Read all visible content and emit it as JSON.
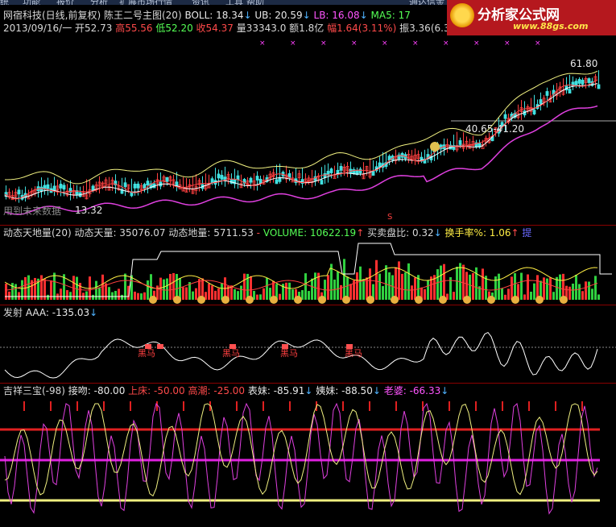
{
  "menu": [
    "统",
    "功能",
    "报价",
    "分析",
    "扩展市场行情",
    "资讯",
    "工具",
    "帮助",
    "通达信金"
  ],
  "logo": {
    "title": "分析家公式网",
    "url": "www.88gs.com"
  },
  "main": {
    "row1": [
      {
        "t": "网宿科技(日线,前复权) 陈王二号主图(20)",
        "c": "#d8d8d8"
      },
      {
        "t": "  BOLL: 18.34",
        "c": "#e8e8e8"
      },
      {
        "t": "↓",
        "c": "#4fb3ff"
      },
      {
        "t": "  UB: 20.59",
        "c": "#e8e8e8"
      },
      {
        "t": "↓",
        "c": "#4fb3ff"
      },
      {
        "t": "  LB: 16.08",
        "c": "#ff55ff"
      },
      {
        "t": "↓",
        "c": "#4fb3ff"
      },
      {
        "t": "        MA5: 17",
        "c": "#55ff55"
      }
    ],
    "row2": [
      {
        "t": "2013/09/16/一 开52.73 ",
        "c": "#d8d8d8"
      },
      {
        "t": "高55.56 ",
        "c": "#ff4a4a"
      },
      {
        "t": "低52.20 ",
        "c": "#55ff55"
      },
      {
        "t": "收54.37 ",
        "c": "#ff4a4a"
      },
      {
        "t": "量33343.0 额1.8亿 ",
        "c": "#d8d8d8"
      },
      {
        "t": "幅1.64(3.11%) ",
        "c": "#ff4a4a"
      },
      {
        "t": "振3.36(6.37%) 换3.3",
        "c": "#d8d8d8"
      }
    ],
    "price_labels": {
      "high": "61.80",
      "mid": "40.65-41.20",
      "low": "13.32"
    },
    "future_text": "用到未来数据"
  },
  "volume": {
    "row": [
      {
        "t": "动态天地量(20) 动态天量: 35076.07 动态地量: 5711.53",
        "c": "#d8d8d8"
      },
      {
        "t": "  -",
        "c": "#ff4a4a"
      },
      {
        "t": "       VOLUME: 10622.19",
        "c": "#55ff55"
      },
      {
        "t": "↑",
        "c": "#ff4a4a"
      },
      {
        "t": "          买卖盘比: 0.32",
        "c": "#d8d8d8"
      },
      {
        "t": "↓",
        "c": "#4fb3ff"
      },
      {
        "t": "   换手率%: 1.06",
        "c": "#ffee44"
      },
      {
        "t": "↑",
        "c": "#ff4a4a"
      },
      {
        "t": "  提",
        "c": "#6a6aff"
      }
    ]
  },
  "fire": {
    "row": [
      {
        "t": "发射",
        "c": "#d8d8d8"
      },
      {
        "t": "     AAA: -135.03",
        "c": "#e8e8e8"
      },
      {
        "t": "↓",
        "c": "#4fb3ff"
      }
    ],
    "marks": [
      "黑马",
      "黑马",
      "黑马",
      "黑马"
    ]
  },
  "jixiang": {
    "row": [
      {
        "t": "吉祥三宝(-98)",
        "c": "#d8d8d8"
      },
      {
        "t": "  接吻: -80.00",
        "c": "#e8e8e8"
      },
      {
        "t": "  上床: -50.00",
        "c": "#ff4a4a"
      },
      {
        "t": "  高潮: -25.00",
        "c": "#ff4a4a"
      },
      {
        "t": "  表妹: -85.91",
        "c": "#e8e8e8"
      },
      {
        "t": "↓",
        "c": "#4fb3ff"
      },
      {
        "t": "  姨妹: -88.50",
        "c": "#e8e8e8"
      },
      {
        "t": "↓",
        "c": "#4fb3ff"
      },
      {
        "t": "  老婆: -66.33",
        "c": "#ff55ff"
      },
      {
        "t": "↓",
        "c": "#4fb3ff"
      }
    ]
  }
}
